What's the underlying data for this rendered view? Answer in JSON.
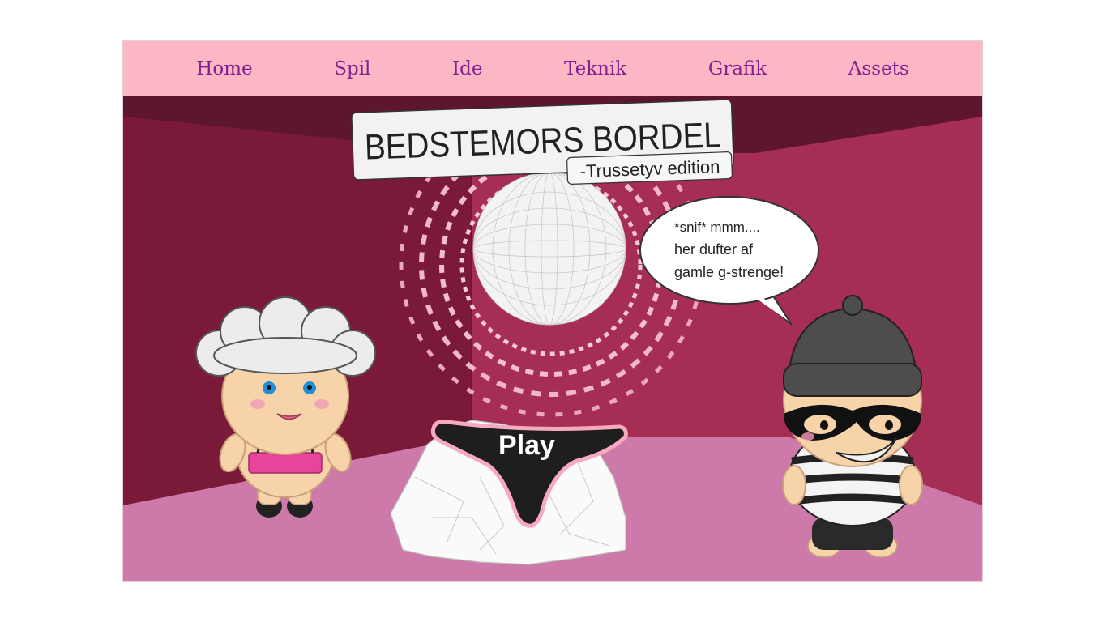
{
  "nav": {
    "items": [
      {
        "label": "Home"
      },
      {
        "label": "Spil"
      },
      {
        "label": "Ide"
      },
      {
        "label": "Teknik"
      },
      {
        "label": "Grafik"
      },
      {
        "label": "Assets"
      }
    ]
  },
  "game": {
    "title": "BEDSTEMORS BORDEL",
    "subtitle": "-Trussetyv edition",
    "speech": {
      "line1": "*snif* mmm....",
      "line2": "her dufter af",
      "line3": "gamle g-strenge!"
    },
    "play_label": "Play"
  },
  "colors": {
    "nav_bg": "#fdb6c3",
    "nav_text": "#83208f",
    "back_wall": "#a62e55",
    "left_wall": "#7a1a38",
    "ceiling": "#5e1530",
    "floor": "#cd7aaa"
  }
}
